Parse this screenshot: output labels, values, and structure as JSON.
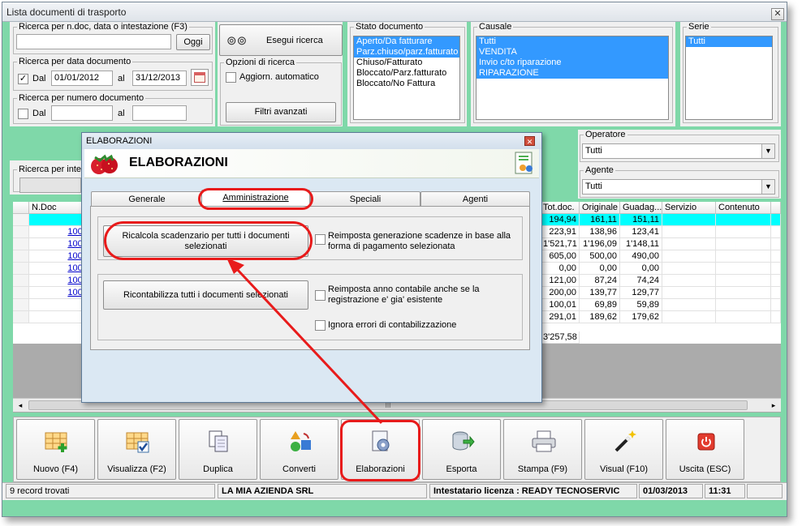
{
  "window": {
    "title": "Lista documenti di trasporto",
    "close": "✕"
  },
  "search": {
    "text_legend": "Ricerca per n.doc, data o intestazione (F3)",
    "text_value": "",
    "today_button": "Oggi",
    "date_legend": "Ricerca per data documento",
    "date_from_label": "Dal",
    "date_from_checked": "✓",
    "date_from": "01/01/2012",
    "date_to_label": "al",
    "date_to": "31/12/2013",
    "number_legend": "Ricerca per numero documento",
    "number_from_label": "Dal",
    "number_to_label": "al",
    "intest_legend": "Ricerca per inte"
  },
  "run_search": {
    "label": "Esegui ricerca"
  },
  "options": {
    "legend": "Opzioni di ricerca",
    "auto_update": "Aggiorn. automatico",
    "advanced_filters": "Filtri avanzati"
  },
  "stato": {
    "legend": "Stato documento",
    "items": [
      {
        "label": "Aperto/Da fatturare",
        "selected": true
      },
      {
        "label": "Parz.chiuso/parz.fatturato",
        "selected": true
      },
      {
        "label": "Chiuso/Fatturato",
        "selected": false
      },
      {
        "label": "Bloccato/Parz.fatturato",
        "selected": false
      },
      {
        "label": "Bloccato/No Fattura",
        "selected": false
      }
    ]
  },
  "causale": {
    "legend": "Causale",
    "items": [
      {
        "label": "Tutti",
        "selected": true
      },
      {
        "label": "VENDITA",
        "selected": true
      },
      {
        "label": "Invio c/to riparazione",
        "selected": true
      },
      {
        "label": "RIPARAZIONE",
        "selected": true
      }
    ]
  },
  "serie": {
    "legend": "Serie",
    "items": [
      {
        "label": "Tutti",
        "selected": true
      }
    ]
  },
  "operatore": {
    "legend": "Operatore",
    "value": "Tutti"
  },
  "agente": {
    "legend": "Agente",
    "value": "Tutti"
  },
  "grid": {
    "headers": {
      "ndoc": "N.Doc",
      "tot": "Tot.doc.",
      "orig": "Originale",
      "guad": "Guadag...",
      "serv": "Servizio",
      "cont": "Contenuto"
    },
    "rows": [
      {
        "ndoc": "1",
        "tot": "194,94",
        "orig": "161,11",
        "guad": "151,11"
      },
      {
        "ndoc": "10001",
        "tot": "223,91",
        "orig": "138,96",
        "guad": "123,41"
      },
      {
        "ndoc": "10002",
        "tot": "1'521,71",
        "orig": "1'196,09",
        "guad": "1'148,11"
      },
      {
        "ndoc": "10003",
        "tot": "605,00",
        "orig": "500,00",
        "guad": "490,00"
      },
      {
        "ndoc": "10004",
        "tot": "0,00",
        "orig": "0,00",
        "guad": "0,00"
      },
      {
        "ndoc": "10006",
        "tot": "121,00",
        "orig": "87,24",
        "guad": "74,24"
      },
      {
        "ndoc": "10007",
        "tot": "200,00",
        "orig": "139,77",
        "guad": "129,77"
      },
      {
        "ndoc": "1",
        "tot": "100,01",
        "orig": "69,89",
        "guad": "59,89"
      },
      {
        "ndoc": "2",
        "tot": "291,01",
        "orig": "189,62",
        "guad": "179,62"
      }
    ],
    "total": "3'257,58",
    "scroll_left": "◂",
    "scroll_right": "▸",
    "scroll_thumb": "III"
  },
  "toolbar": {
    "nuovo": "Nuovo (F4)",
    "visualizza": "Visualizza (F2)",
    "duplica": "Duplica",
    "converti": "Converti",
    "elaborazioni": "Elaborazioni",
    "esporta": "Esporta",
    "stampa": "Stampa (F9)",
    "visual": "Visual (F10)",
    "uscita": "Uscita (ESC)"
  },
  "status": {
    "records": "9 record trovati",
    "company": "LA MIA AZIENDA SRL",
    "license": "Intestatario licenza : READY TECNOSERVIC",
    "date": "01/03/2013",
    "time": "11:31"
  },
  "dialog": {
    "titlebar": "ELABORAZIONI",
    "close": "✕",
    "heading": "ELABORAZIONI",
    "tabs": {
      "generale": "Generale",
      "amministrazione": "Amministrazione",
      "speciali": "Speciali",
      "agenti": "Agenti"
    },
    "ricalcola_button": "Ricalcola scadenzario per tutti i documenti selezionati",
    "reimposta_scadenze": "Reimposta generazione scadenze in base alla forma di pagamento selezionata",
    "ricontabilizza_button": "Ricontabilizza tutti i documenti selezionati",
    "reimposta_anno": "Reimposta anno contabile anche se la registrazione e' gia' esistente",
    "ignora_errori": "Ignora errori di contabilizzazione"
  },
  "colors": {
    "accent_green": "#7fd8a9",
    "selection_blue": "#3399ff",
    "highlight_row": "#00ffff",
    "annotation_red": "#e81b1b"
  }
}
